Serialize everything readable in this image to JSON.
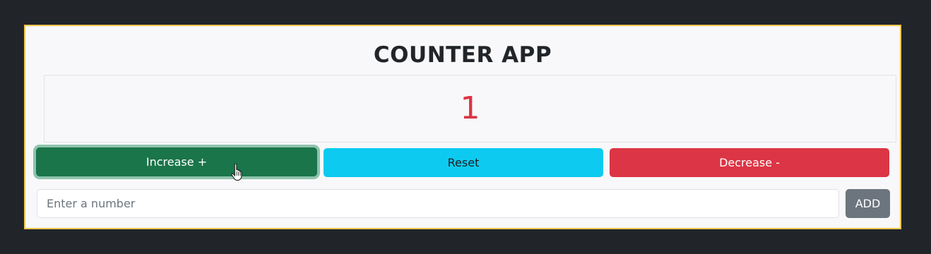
{
  "app": {
    "title": "COUNTER APP"
  },
  "counter": {
    "value": "1"
  },
  "buttons": {
    "increase_label": "Increase +",
    "reset_label": "Reset",
    "decrease_label": "Decrease -",
    "add_label": "ADD"
  },
  "number_input": {
    "placeholder": "Enter a number",
    "value": ""
  },
  "icons": {
    "cursor": "hand-pointer-icon"
  },
  "colors": {
    "page_background": "#212529",
    "card_background": "#f8f8fa",
    "card_border": "#f0c64a",
    "counter_text": "#dc3545",
    "increase_button": "#1a754a",
    "reset_button": "#0dcaf0",
    "decrease_button": "#dc3545",
    "add_button": "#6c757d"
  }
}
